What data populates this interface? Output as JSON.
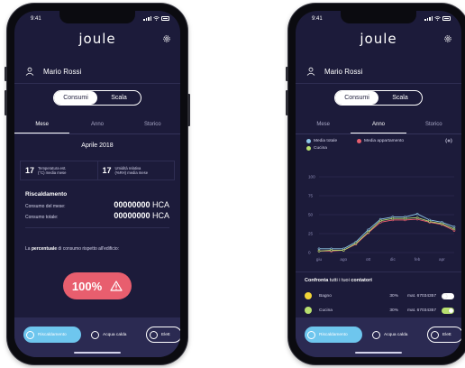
{
  "colors": {
    "background": "#1c1b3a",
    "bottom_bar": "#2b2a52",
    "accent_blue": "#6ec6ee",
    "alert_red": "#e85e6e",
    "series_total": "#8ec8e8",
    "series_apartment": "#e85e6e",
    "series_kitchen": "#b8e06f",
    "room_bagno": "#f2d538",
    "room_cucina": "#b8e06f"
  },
  "screen1": {
    "status": {
      "time": "9:41"
    },
    "app": {
      "logo": "joule",
      "settings_icon": "gear-icon"
    },
    "user": {
      "name": "Mario Rossi",
      "icon": "user-icon"
    },
    "segmented": {
      "left": "Consumi",
      "right": "Scala",
      "selected": "Consumi"
    },
    "tabs": [
      {
        "label": "Mese"
      },
      {
        "label": "Anno"
      },
      {
        "label": "Storico"
      }
    ],
    "selected_tab": "Mese",
    "period": "Aprile 2018",
    "stats": [
      {
        "value": "17",
        "label_line1": "Temperatura est.",
        "label_line2": "(°C) media mese"
      },
      {
        "value": "17",
        "label_line1": "Umidità relativa",
        "label_line2": "(%RH) media mese"
      }
    ],
    "section": "Riscaldamento",
    "rows": [
      {
        "label": "Consumo del mese:",
        "value": "00000000",
        "unit": "HCA"
      },
      {
        "label": "Consumo totale:",
        "value": "00000000",
        "unit": "HCA"
      }
    ],
    "note": {
      "prefix": "La ",
      "bold": "percentuale",
      "suffix": " di consumo rispetto all'edificio:"
    },
    "percentage": {
      "value": "100%",
      "icon": "warning-icon"
    },
    "bottom_tabs": [
      {
        "label": "Riscaldamento"
      },
      {
        "label": "Acqua calda"
      },
      {
        "label": "Elett"
      }
    ]
  },
  "screen2": {
    "status": {
      "time": "9:41"
    },
    "app": {
      "logo": "joule",
      "settings_icon": "gear-icon"
    },
    "user": {
      "name": "Mario Rossi",
      "icon": "user-icon"
    },
    "segmented": {
      "left": "Consumi",
      "right": "Scala",
      "selected": "Consumi"
    },
    "tabs": [
      {
        "label": "Mese"
      },
      {
        "label": "Anno"
      },
      {
        "label": "Storico"
      }
    ],
    "selected_tab": "Anno",
    "legend": [
      {
        "label": "Media totale"
      },
      {
        "label": "Media appartamento"
      },
      {
        "label": "Cucina"
      }
    ],
    "compare": {
      "prefix": "Confronta",
      "middle": " tutti i tuoi ",
      "bold": "contatori"
    },
    "rooms": [
      {
        "name": "Bagno",
        "percent": "30%",
        "mat": "mat. 67034357",
        "enabled": false
      },
      {
        "name": "Cucina",
        "percent": "30%",
        "mat": "mat. 67034357",
        "enabled": true
      }
    ],
    "bottom_tabs": [
      {
        "label": "Riscaldamento"
      },
      {
        "label": "Acqua calda"
      },
      {
        "label": "Elett"
      }
    ]
  },
  "chart_data": {
    "type": "line",
    "categories": [
      "giu",
      "lug",
      "ago",
      "set",
      "ott",
      "nov",
      "dic",
      "gen",
      "feb",
      "mar",
      "apr",
      "mag"
    ],
    "x_tick_labels": [
      "giu",
      "ago",
      "ott",
      "dic",
      "feb",
      "apr"
    ],
    "y_tick_labels": [
      "0",
      "25",
      "50",
      "75",
      "100"
    ],
    "ylim": [
      0,
      100
    ],
    "grid": true,
    "legend_position": "top",
    "series": [
      {
        "name": "Media totale",
        "color": "#8ec8e8",
        "values": [
          5,
          5,
          5,
          14,
          30,
          44,
          47,
          47,
          51,
          43,
          40,
          34
        ]
      },
      {
        "name": "Media appartamento",
        "color": "#e85e6e",
        "values": [
          2,
          2,
          3,
          11,
          26,
          40,
          43,
          43,
          44,
          40,
          37,
          29
        ]
      },
      {
        "name": "Cucina",
        "color": "#b8e06f",
        "values": [
          2,
          3,
          3,
          12,
          27,
          42,
          45,
          45,
          46,
          41,
          38,
          31
        ]
      }
    ]
  }
}
